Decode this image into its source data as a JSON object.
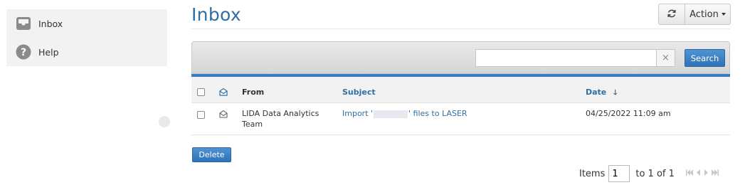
{
  "sidebar": {
    "items": [
      {
        "label": "Inbox",
        "icon": "inbox-tray-icon"
      },
      {
        "label": "Help",
        "icon": "help-icon"
      }
    ]
  },
  "header": {
    "title": "Inbox",
    "refresh_icon": "refresh-icon",
    "action_label": "Action"
  },
  "toolbar": {
    "search_value": "",
    "clear_glyph": "×",
    "search_label": "Search"
  },
  "table": {
    "columns": {
      "from": "From",
      "subject": "Subject",
      "date": "Date"
    },
    "sort_indicator": "🡓",
    "rows": [
      {
        "from": "LIDA Data Analytics Team",
        "subject_prefix": "Import '",
        "subject_suffix": "' files to LASER",
        "date": "04/25/2022 11:09 am"
      }
    ]
  },
  "footer": {
    "delete_label": "Delete",
    "items_label": "Items",
    "page_value": "1",
    "range_text": "to 1 of 1"
  },
  "colors": {
    "accent": "#2f6fa7",
    "button_blue": "#3b7cc0"
  }
}
